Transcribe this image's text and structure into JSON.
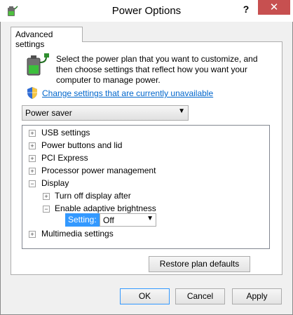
{
  "window": {
    "title": "Power Options",
    "help_label": "?",
    "close_label": "✕"
  },
  "tabs": [
    {
      "label": "Advanced settings"
    }
  ],
  "intro_text": "Select the power plan that you want to customize, and then choose settings that reflect how you want your computer to manage power.",
  "change_settings_link": "Change settings that are currently unavailable",
  "plan_select": {
    "value": "Power saver"
  },
  "tree": {
    "items": [
      {
        "label": "USB settings",
        "expander": "+"
      },
      {
        "label": "Power buttons and lid",
        "expander": "+"
      },
      {
        "label": "PCI Express",
        "expander": "+"
      },
      {
        "label": "Processor power management",
        "expander": "+"
      },
      {
        "label": "Display",
        "expander": "−"
      },
      {
        "label": "Turn off display after",
        "expander": "+"
      },
      {
        "label": "Enable adaptive brightness",
        "expander": "−"
      },
      {
        "label": "Multimedia settings",
        "expander": "+"
      }
    ],
    "setting_label": "Setting:",
    "setting_value": "Off"
  },
  "buttons": {
    "restore": "Restore plan defaults",
    "ok": "OK",
    "cancel": "Cancel",
    "apply": "Apply"
  },
  "icons": {
    "app": "power-options-icon",
    "battery": "battery-power-icon",
    "shield": "uac-shield-icon"
  },
  "colors": {
    "close_button": "#c75050",
    "link": "#0066cc",
    "selection": "#3399ff"
  }
}
